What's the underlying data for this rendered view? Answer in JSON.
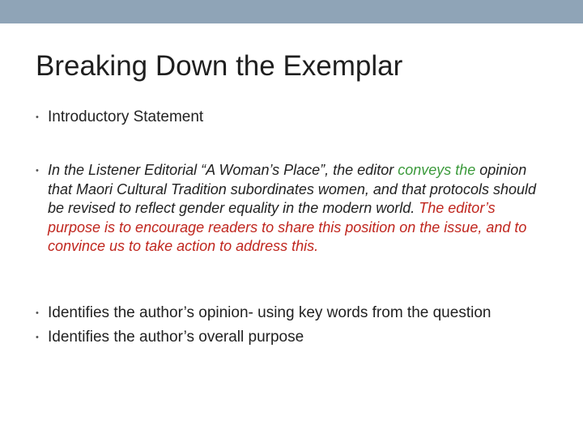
{
  "slide": {
    "title": "Breaking Down the Exemplar",
    "bullets": {
      "introductory": "Introductory Statement",
      "exemplar": {
        "segment_1": "In the Listener Editorial “A Woman’s Place”, the editor ",
        "segment_2": "conveys the",
        "segment_3": " opinion that Maori Cultural Tradition subordinates women, and that protocols should be revised to reflect gender equality in the modern world. ",
        "segment_4": "The editor’s purpose is to encourage readers to share this position on the issue, and to convince us to take action to address this."
      },
      "opinion": "Identifies the author’s opinion- using key words from the question",
      "purpose": "Identifies the author’s overall purpose"
    },
    "bullet_glyph": "•"
  },
  "colors": {
    "top_bar": "#8fa4b7",
    "highlight_green": "#3b9a3b",
    "highlight_red": "#c0261e"
  }
}
